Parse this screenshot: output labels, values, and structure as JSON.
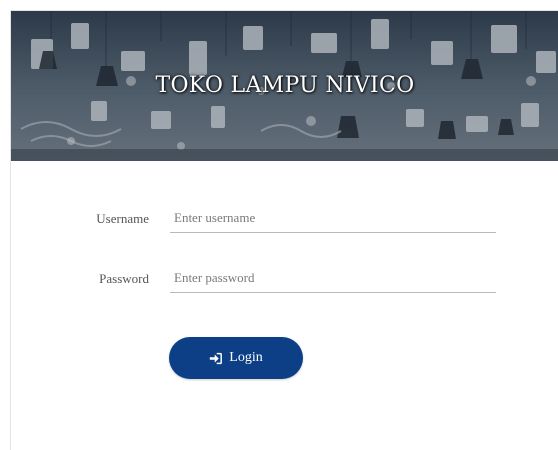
{
  "banner": {
    "title": "TOKO LAMPU NIVICO"
  },
  "form": {
    "username": {
      "label": "Username",
      "placeholder": "Enter username",
      "value": ""
    },
    "password": {
      "label": "Password",
      "placeholder": "Enter password",
      "value": ""
    },
    "login_button": {
      "label": "Login",
      "icon": "sign-in-icon"
    }
  },
  "colors": {
    "button": "#0d3f87",
    "banner": "#566575",
    "background": "#ffffff"
  }
}
